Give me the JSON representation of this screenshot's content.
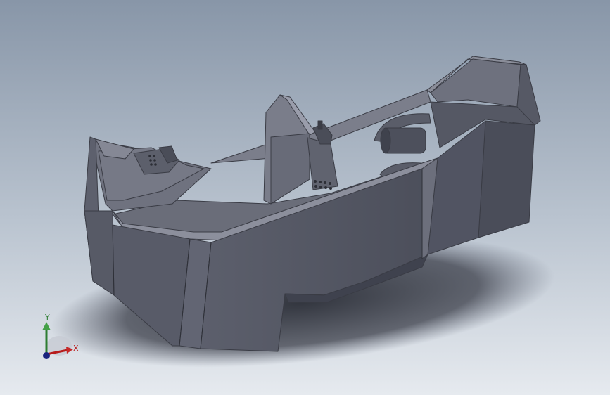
{
  "viewport": {
    "background_top": "#8896a8",
    "background_bottom": "#e6eaef"
  },
  "model": {
    "body_color": "#5f6270",
    "shadow_color": "#2a2d36"
  },
  "triad": {
    "x_label": "X",
    "y_label": "Y",
    "x_color": "#b71c1c",
    "y_color": "#2e7d32",
    "z_color": "#1a237e"
  }
}
